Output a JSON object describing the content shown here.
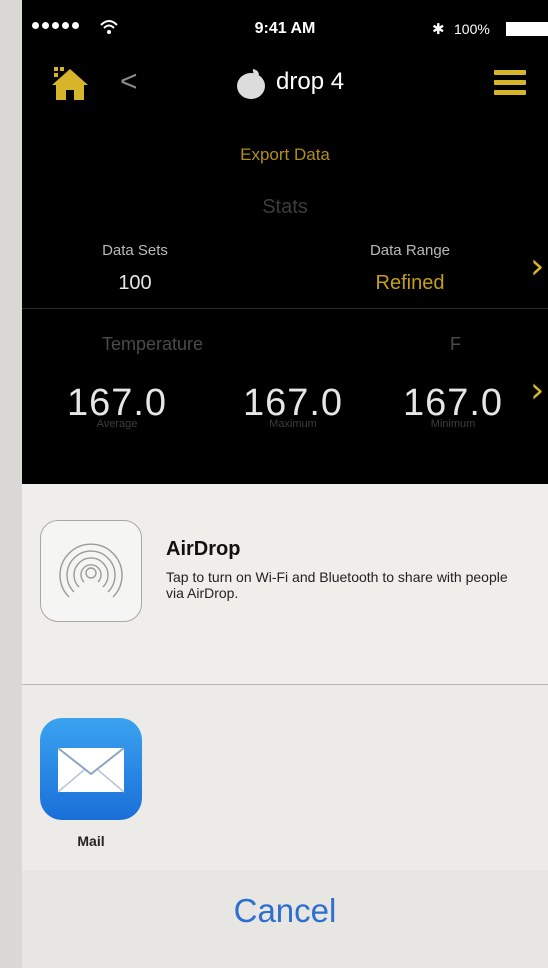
{
  "status_bar": {
    "time": "9:41 AM",
    "battery": "100%",
    "signal_icon": "signal-dots-icon",
    "wifi_icon": "wifi-icon",
    "bluetooth_icon": "bluetooth-icon"
  },
  "nav": {
    "title": "drop 4",
    "back_symbol": "<",
    "home_icon": "home-icon",
    "menu_icon": "menu-icon",
    "accent_color": "#d6b52b"
  },
  "export_label": "Export Data",
  "stats_title": "Stats",
  "stats": {
    "data_sets_label": "Data Sets",
    "data_sets_value": "100",
    "data_range_label": "Data Range",
    "data_range_value": "Refined"
  },
  "temperature": {
    "label": "Temperature",
    "label2": "F",
    "values": [
      "167.0",
      "167.0",
      "167.0"
    ],
    "captions": [
      "Average",
      "Maximum",
      "Minimum"
    ]
  },
  "share": {
    "airdrop_title": "AirDrop",
    "airdrop_desc": "Tap to turn on Wi-Fi and Bluetooth to share with people via AirDrop.",
    "apps": [
      {
        "label": "Mail",
        "icon": "mail-icon"
      }
    ],
    "cancel": "Cancel"
  }
}
